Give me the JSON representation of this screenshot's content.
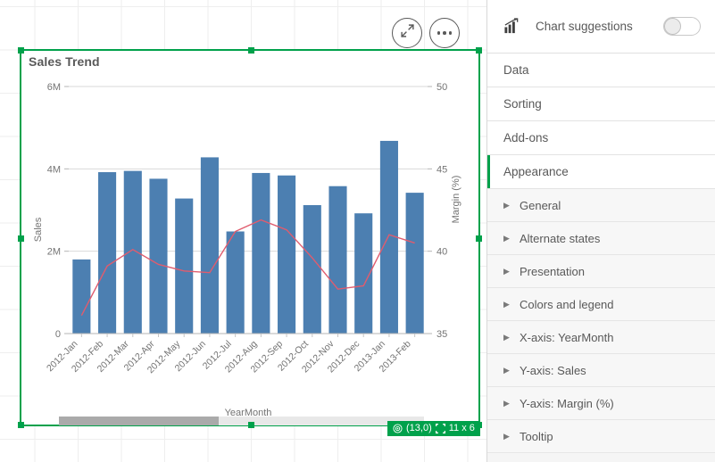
{
  "chart_object": {
    "title": "Sales Trend",
    "expand_icon": "expand-arrows-icon",
    "menu_icon": "ellipsis-icon",
    "size_badge": {
      "position_icon": "target-icon",
      "position": "(13,0)",
      "size_icon": "resize-icon",
      "size": "11 x 6"
    }
  },
  "chart_data": {
    "type": "bar",
    "title": "Sales Trend",
    "xlabel": "YearMonth",
    "ylabel": "Sales",
    "y2label": "Margin (%)",
    "categories": [
      "2012-Jan",
      "2012-Feb",
      "2012-Mar",
      "2012-Apr",
      "2012-May",
      "2012-Jun",
      "2012-Jul",
      "2012-Aug",
      "2012-Sep",
      "2012-Oct",
      "2012-Nov",
      "2012-Dec",
      "2013-Jan",
      "2013-Feb"
    ],
    "series": [
      {
        "name": "Sales",
        "type": "bar",
        "axis": "left",
        "color": "#4C7FB1",
        "values": [
          1800000,
          3920000,
          3950000,
          3760000,
          3280000,
          4280000,
          2480000,
          3900000,
          3840000,
          3120000,
          3580000,
          2920000,
          4680000,
          3420000
        ]
      },
      {
        "name": "Margin (%)",
        "type": "line",
        "axis": "right",
        "color": "#E05C6E",
        "values": [
          36.1,
          39.1,
          40.1,
          39.2,
          38.8,
          38.7,
          41.2,
          41.9,
          41.3,
          39.6,
          37.7,
          37.9,
          41.0,
          40.5
        ]
      }
    ],
    "yaxis": {
      "ticks": [
        "0",
        "2M",
        "4M",
        "6M"
      ],
      "tick_values": [
        0,
        2000000,
        4000000,
        6000000
      ],
      "ylim": [
        0,
        6000000
      ]
    },
    "y2axis": {
      "ticks": [
        "35",
        "40",
        "45",
        "50"
      ],
      "tick_values": [
        35,
        40,
        45,
        50
      ],
      "ylim": [
        35,
        50
      ]
    },
    "grid": true,
    "legend": "none"
  },
  "panel": {
    "header": {
      "icon": "chart-suggestions-icon",
      "label": "Chart suggestions",
      "toggle_state": "off"
    },
    "sections": [
      {
        "label": "Data",
        "active": false
      },
      {
        "label": "Sorting",
        "active": false
      },
      {
        "label": "Add-ons",
        "active": false
      },
      {
        "label": "Appearance",
        "active": true
      }
    ],
    "subsections": [
      {
        "label": "General"
      },
      {
        "label": "Alternate states"
      },
      {
        "label": "Presentation"
      },
      {
        "label": "Colors and legend"
      },
      {
        "label": "X-axis: YearMonth"
      },
      {
        "label": "Y-axis: Sales"
      },
      {
        "label": "Y-axis: Margin (%)"
      },
      {
        "label": "Tooltip"
      }
    ]
  },
  "colors": {
    "accent_green": "#00A14B",
    "bar_blue": "#4C7FB1",
    "line_pink": "#E05C6E",
    "text_gray": "#595959"
  }
}
